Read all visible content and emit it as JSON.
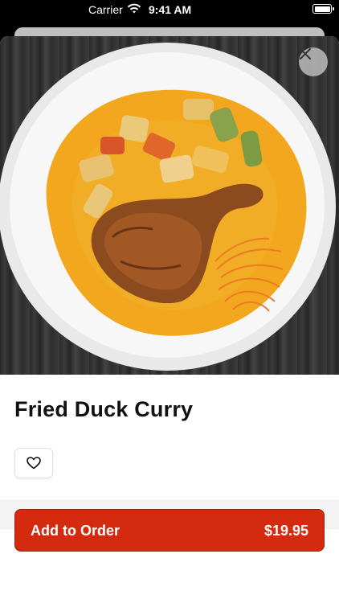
{
  "status_bar": {
    "carrier": "Carrier",
    "time": "9:41 AM"
  },
  "item": {
    "name": "Fried Duck Curry",
    "image_icon": "food-photo"
  },
  "actions": {
    "add_label": "Add to Order",
    "price": "$19.95"
  },
  "colors": {
    "accent": "#d42a0f",
    "curry": "#f2a71e"
  },
  "icons": {
    "close": "close-icon",
    "favorite": "heart-icon"
  }
}
